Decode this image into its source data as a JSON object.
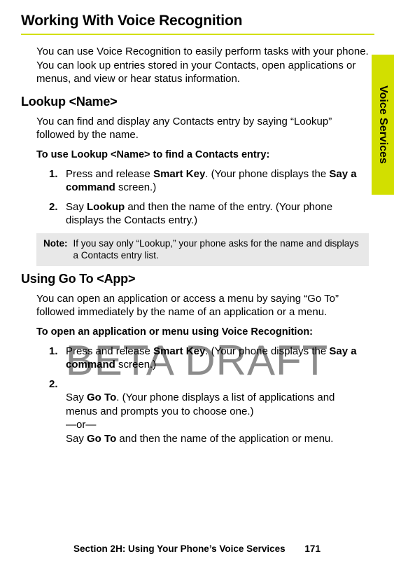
{
  "title": "Working With Voice Recognition",
  "intro": "You can use Voice Recognition to easily perform tasks with your phone. You can look up entries stored in your Contacts, open applications or menus, and view or hear status information.",
  "sideTab": "Voice Services",
  "watermark": "BETA DRAFT",
  "sections": [
    {
      "heading": "Lookup <Name>",
      "lead": "You can find and display any Contacts entry by saying “Lookup” followed by the name.",
      "subhead": "To use Lookup <Name> to find a Contacts entry:",
      "steps": [
        {
          "n": "1.",
          "pre": "Press and release ",
          "b1": "Smart Key",
          "mid": ". (Your phone displays the ",
          "b2": "Say a command",
          "post": " screen.)"
        },
        {
          "n": "2.",
          "pre": "Say ",
          "b1": "Lookup",
          "mid": " and then the name of the entry. (Your phone displays the Contacts entry.)",
          "b2": "",
          "post": ""
        }
      ],
      "note": {
        "label": "Note:",
        "text": "If you say only “Lookup,” your phone asks for the name and displays a Contacts entry list."
      }
    },
    {
      "heading": "Using Go To <App>",
      "lead": "You can open an application or access a menu by saying “Go To” followed immediately by the name of an application or a menu.",
      "subhead": "To open an application or menu using Voice Recognition:",
      "steps": [
        {
          "n": "1.",
          "pre": "Press and release ",
          "b1": "Smart Key",
          "mid": ". (Your phone displays the ",
          "b2": "Say a command",
          "post": " screen.)"
        },
        {
          "n": "2.",
          "pre": "Say ",
          "b1": "Go To",
          "mid": ". (Your phone displays a list of applications and menus and prompts you to choose one.)\n—or—\nSay ",
          "b2": "Go To",
          "post": " and then the name of the application or menu."
        }
      ]
    }
  ],
  "footer": {
    "section": "Section 2H: Using Your Phone’s Voice Services",
    "page": "171"
  }
}
